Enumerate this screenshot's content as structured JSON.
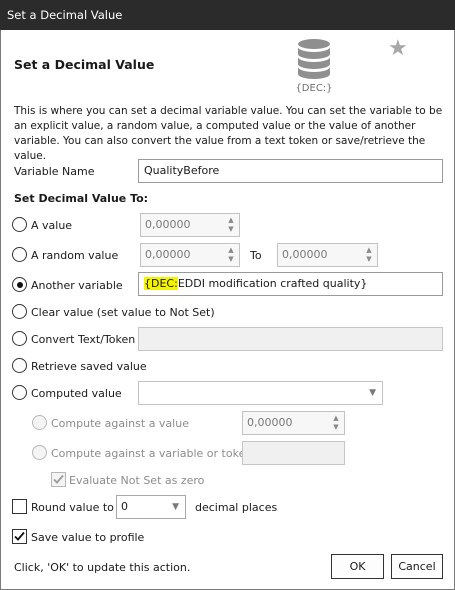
{
  "window": {
    "title": "Set a Decimal Value"
  },
  "header": {
    "heading": "Set a Decimal Value",
    "icon_caption": "{DEC:}",
    "description": "This is where you can set a decimal variable value.  You can set the variable to be an explicit value, a random value, a computed value or the value of another variable.  You can also convert the value from a text token or save/retrieve the value."
  },
  "variable_name": {
    "label": "Variable Name",
    "value": "QualityBefore"
  },
  "set_to_label": "Set Decimal Value To:",
  "options": {
    "a_value": {
      "label": "A value",
      "value": "0,00000",
      "selected": false
    },
    "a_random_value": {
      "label": "A random value",
      "from": "0,00000",
      "to_label": "To",
      "to": "0,00000",
      "selected": false
    },
    "another_variable": {
      "label": "Another variable",
      "token_highlight": "{DEC:",
      "token_rest": "EDDI modification crafted quality}",
      "selected": true
    },
    "clear_value": {
      "label": "Clear value (set value to Not Set)",
      "selected": false
    },
    "convert_text": {
      "label": "Convert Text/Token",
      "value": "",
      "selected": false
    },
    "retrieve_saved": {
      "label": "Retrieve saved value",
      "selected": false
    },
    "computed_value": {
      "label": "Computed value",
      "selected_option": "",
      "selected": false
    }
  },
  "compute": {
    "against_value": {
      "label": "Compute against a value",
      "value": "0,00000"
    },
    "against_variable": {
      "label": "Compute against a variable or token",
      "value": ""
    },
    "evaluate_not_set": {
      "label": "Evaluate Not Set as zero",
      "checked": true
    }
  },
  "round": {
    "label": "Round value to",
    "value": "0",
    "suffix": "decimal places",
    "checked": false
  },
  "save_profile": {
    "label": "Save value to profile",
    "checked": true
  },
  "footer": {
    "hint": "Click, 'OK' to update this action.",
    "ok_label": "OK",
    "cancel_label": "Cancel"
  },
  "icons": {
    "database": "database-icon",
    "star": "star-icon"
  }
}
